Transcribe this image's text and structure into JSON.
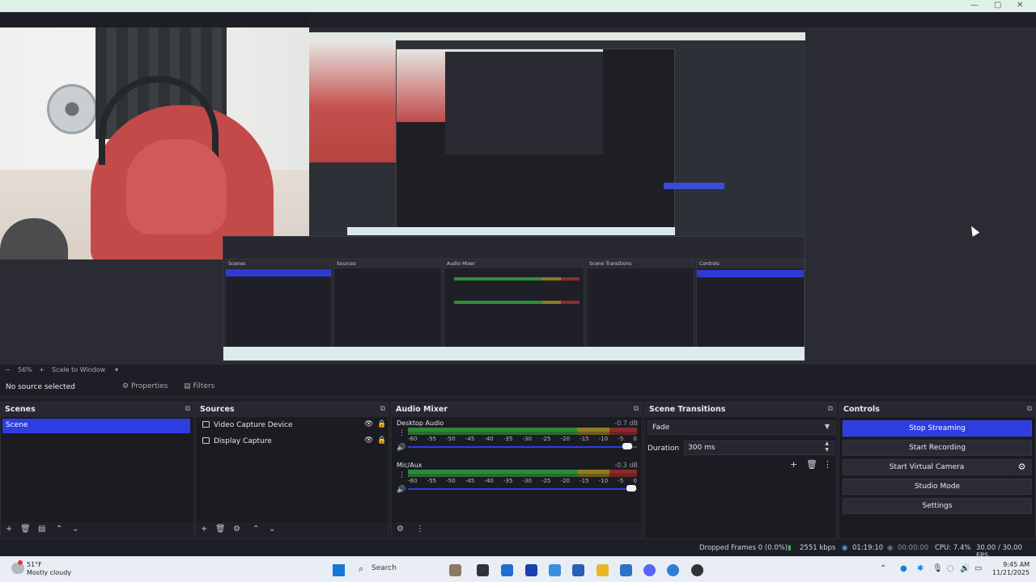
{
  "window": {
    "controls": [
      "—",
      "▢",
      "✕"
    ]
  },
  "preview_bar": {
    "zoom_out": "−",
    "zoom": "56%",
    "zoom_in": "+",
    "scale_mode": "Scale to Window",
    "dropdown": "▾"
  },
  "source_toolbar": {
    "no_selection": "No source selected",
    "properties": "Properties",
    "filters": "Filters"
  },
  "scenes": {
    "title": "Scenes",
    "items": [
      {
        "label": "Scene",
        "selected": true
      }
    ]
  },
  "sources": {
    "title": "Sources",
    "items": [
      {
        "label": "Video Capture Device",
        "icon": "camera-icon",
        "visible": true,
        "locked": true
      },
      {
        "label": "Display Capture",
        "icon": "monitor-icon",
        "visible": true,
        "locked": true
      }
    ]
  },
  "audio_mixer": {
    "title": "Audio Mixer",
    "channels": [
      {
        "name": "Desktop Audio",
        "db": "-0.7 dB",
        "volume_fraction": 0.97
      },
      {
        "name": "Mic/Aux",
        "db": "-0.3 dB",
        "volume_fraction": 0.99
      }
    ],
    "ticks": [
      "-60",
      "-55",
      "-50",
      "-45",
      "-40",
      "-35",
      "-30",
      "-25",
      "-20",
      "-15",
      "-10",
      "-5",
      "0"
    ]
  },
  "scene_transitions": {
    "title": "Scene Transitions",
    "transition": "Fade",
    "duration_label": "Duration",
    "duration_value": "300 ms"
  },
  "controls": {
    "title": "Controls",
    "stop_streaming": "Stop Streaming",
    "start_recording": "Start Recording",
    "start_virtual_camera": "Start Virtual Camera",
    "studio_mode": "Studio Mode",
    "settings": "Settings"
  },
  "status": {
    "dropped_frames": "Dropped Frames 0 (0.0%)",
    "bitrate": "2551 kbps",
    "stream_time": "01:19:10",
    "rec_time": "00:00:00",
    "cpu": "CPU: 7.4%",
    "fps": "30.00 / 30.00 FPS"
  },
  "taskbar": {
    "weather_temp": "51°F",
    "weather_desc": "Mostly cloudy",
    "search": "Search",
    "time": "9:45 AM",
    "date": "11/21/2025"
  },
  "colors": {
    "accent": "#2e3de0",
    "dock_bg": "#1b1c22",
    "meter_green": "#2e8a3a",
    "meter_yellow": "#8f7c21",
    "meter_red": "#8d2a2a"
  }
}
